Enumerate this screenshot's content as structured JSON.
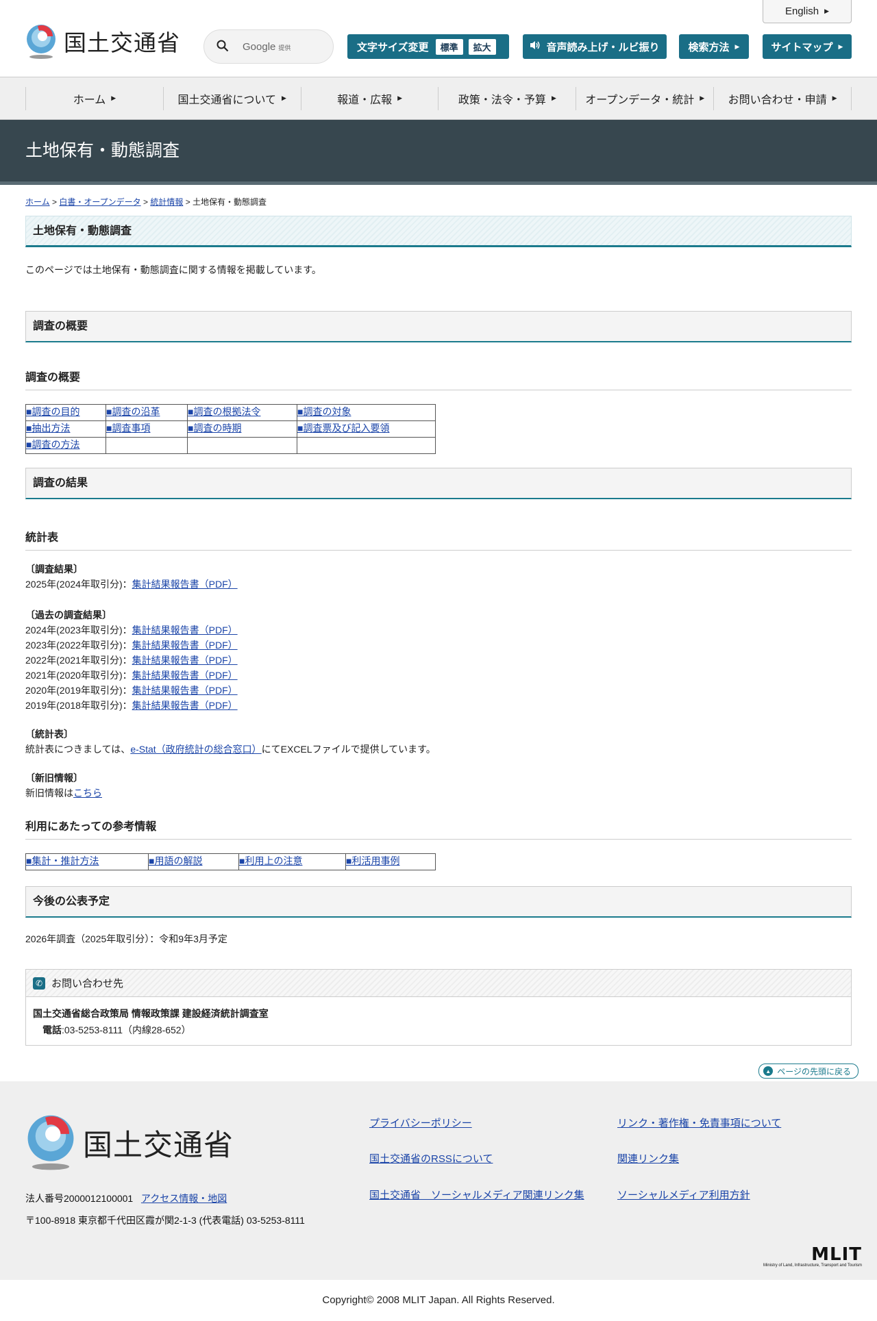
{
  "header": {
    "logo_text": "国土交通省",
    "english_label": "English",
    "search_placeholder": "Google",
    "search_provided": "提供",
    "font_size_label": "文字サイズ変更",
    "font_size_normal": "標準",
    "font_size_large": "拡大",
    "voice_label": "音声読み上げ・ルビ振り",
    "search_method_label": "検索方法",
    "sitemap_label": "サイトマップ"
  },
  "nav": {
    "items": [
      "ホーム",
      "国土交通省について",
      "報道・広報",
      "政策・法令・予算",
      "オープンデータ・統計",
      "お問い合わせ・申請"
    ]
  },
  "page": {
    "title": "土地保有・動態調査",
    "breadcrumb": {
      "home": "ホーム",
      "sep": ">",
      "white_paper": "白書・オープンデータ",
      "stats": "統計情報",
      "current": "土地保有・動態調査"
    },
    "heading": "土地保有・動態調査",
    "intro": "このページでは土地保有・動態調査に関する情報を掲載しています。"
  },
  "overview": {
    "section_title": "調査の概要",
    "subheading": "調査の概要",
    "links": [
      [
        "■調査の目的",
        "■調査の沿革",
        "■調査の根拠法令",
        "■調査の対象"
      ],
      [
        "■抽出方法",
        "■調査事項",
        "■調査の時期",
        "■調査票及び記入要領"
      ],
      [
        "■調査の方法",
        "",
        "",
        ""
      ]
    ]
  },
  "results": {
    "section_title": "調査の結果",
    "subheading": "統計表",
    "current_label": "〔調査結果〕",
    "current_item": {
      "year": "2025年(2024年取引分)：",
      "link": "集計結果報告書（PDF）"
    },
    "past_label": "〔過去の調査結果〕",
    "past_items": [
      {
        "year": "2024年(2023年取引分)：",
        "link": "集計結果報告書（PDF）"
      },
      {
        "year": "2023年(2022年取引分)：",
        "link": "集計結果報告書（PDF）"
      },
      {
        "year": "2022年(2021年取引分)：",
        "link": "集計結果報告書（PDF）"
      },
      {
        "year": "2021年(2020年取引分)：",
        "link": "集計結果報告書（PDF）"
      },
      {
        "year": "2020年(2019年取引分)：",
        "link": "集計結果報告書（PDF）"
      },
      {
        "year": "2019年(2018年取引分)：",
        "link": "集計結果報告書（PDF）"
      }
    ],
    "stat_label": "〔統計表〕",
    "stat_prefix": "統計表につきましては、",
    "stat_link": "e-Stat（政府統計の総合窓口）",
    "stat_suffix": "にてEXCELファイルで提供しています。",
    "newold_label": "〔新旧情報〕",
    "newold_prefix": "新旧情報は",
    "newold_link": "こちら"
  },
  "reference": {
    "subheading": "利用にあたっての参考情報",
    "links": [
      "■集計・推計方法",
      "■用語の解説",
      "■利用上の注意",
      "■利活用事例"
    ]
  },
  "schedule": {
    "section_title": "今後の公表予定",
    "text": "2026年調査（2025年取引分）：令和9年3月予定"
  },
  "contact": {
    "heading": "お問い合わせ先",
    "org": "国土交通省総合政策局 情報政策課 建設経済統計調査室",
    "phone_label": "電話",
    "phone_value": ":03-5253-8111（内線28-652）"
  },
  "to_top": "ページの先頭に戻る",
  "footer": {
    "logo_text": "国土交通省",
    "corp_number": "法人番号2000012100001",
    "access_link": "アクセス情報・地図",
    "address": "〒100-8918 東京都千代田区霞が関2-1-3 (代表電話) 03-5253-8111",
    "links_col1": [
      "プライバシーポリシー",
      "国土交通省のRSSについて",
      "国土交通省　ソーシャルメディア関連リンク集"
    ],
    "links_col2": [
      "リンク・著作権・免責事項について",
      "関連リンク集",
      "ソーシャルメディア利用方針"
    ],
    "mlit_big": "MLIT",
    "mlit_small": "Ministry of Land, Infrastructure, Transport and Tourism",
    "copyright": "Copyright© 2008 MLIT Japan. All Rights Reserved."
  },
  "colors": {
    "accent": "#1a6e86",
    "title_band": "#37474f",
    "link": "#1a44a8"
  }
}
